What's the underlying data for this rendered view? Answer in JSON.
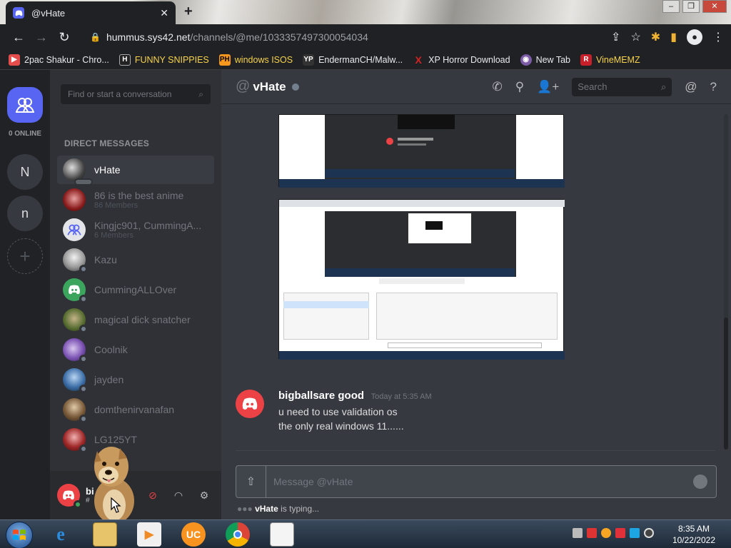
{
  "browser": {
    "tab_title": "@vHate",
    "url_host": "hummus.sys42.net",
    "url_path": "/channels/@me/1033357497300054034",
    "bookmarks": [
      {
        "label": "2pac Shakur - Chro...",
        "icon": "video-icon",
        "color": "#e54c4c"
      },
      {
        "label": "FUNNY SNIPPIES",
        "icon": "H",
        "color": "#222222"
      },
      {
        "label": "windows ISOS",
        "icon": "PH",
        "color": "#f7971e"
      },
      {
        "label": "EndermanCH/Malw...",
        "icon": "YP",
        "color": "#333333"
      },
      {
        "label": "XP Horror Download",
        "icon": "X",
        "color": "#d32323"
      },
      {
        "label": "New Tab",
        "icon": "globe-icon",
        "color": "#7b5ba6"
      },
      {
        "label": "VineMEMZ",
        "icon": "R",
        "color": "#c8202b"
      }
    ]
  },
  "guilds": {
    "online_label": "0 ONLINE",
    "servers": [
      "N",
      "n"
    ]
  },
  "sidebar": {
    "search_placeholder": "Find or start a conversation",
    "header": "DIRECT MESSAGES",
    "dms": [
      {
        "name": "vHate",
        "sub": "",
        "active": true
      },
      {
        "name": "86 is the best anime",
        "sub": "86 Members"
      },
      {
        "name": "Kingjc901, CummingA...",
        "sub": "6 Members"
      },
      {
        "name": "Kazu",
        "sub": ""
      },
      {
        "name": "CummingALLOver",
        "sub": ""
      },
      {
        "name": "magical dick snatcher",
        "sub": ""
      },
      {
        "name": "Coolnik",
        "sub": ""
      },
      {
        "name": "jayden",
        "sub": ""
      },
      {
        "name": "domthenirvanafan",
        "sub": ""
      },
      {
        "name": "LG125YT",
        "sub": ""
      }
    ]
  },
  "userpanel": {
    "name": "bi",
    "tag": "#"
  },
  "channel": {
    "name": "vHate",
    "search_placeholder": "Search"
  },
  "message": {
    "author": "bigballsare good",
    "timestamp": "Today at 5:35 AM",
    "lines": [
      "u need to use validation os",
      "the only real windows 11......"
    ]
  },
  "composer": {
    "placeholder": "Message @vHate"
  },
  "typing": {
    "user": "vHate",
    "text": " is typing..."
  },
  "taskbar": {
    "time": "8:35 AM",
    "date": "10/22/2022"
  }
}
